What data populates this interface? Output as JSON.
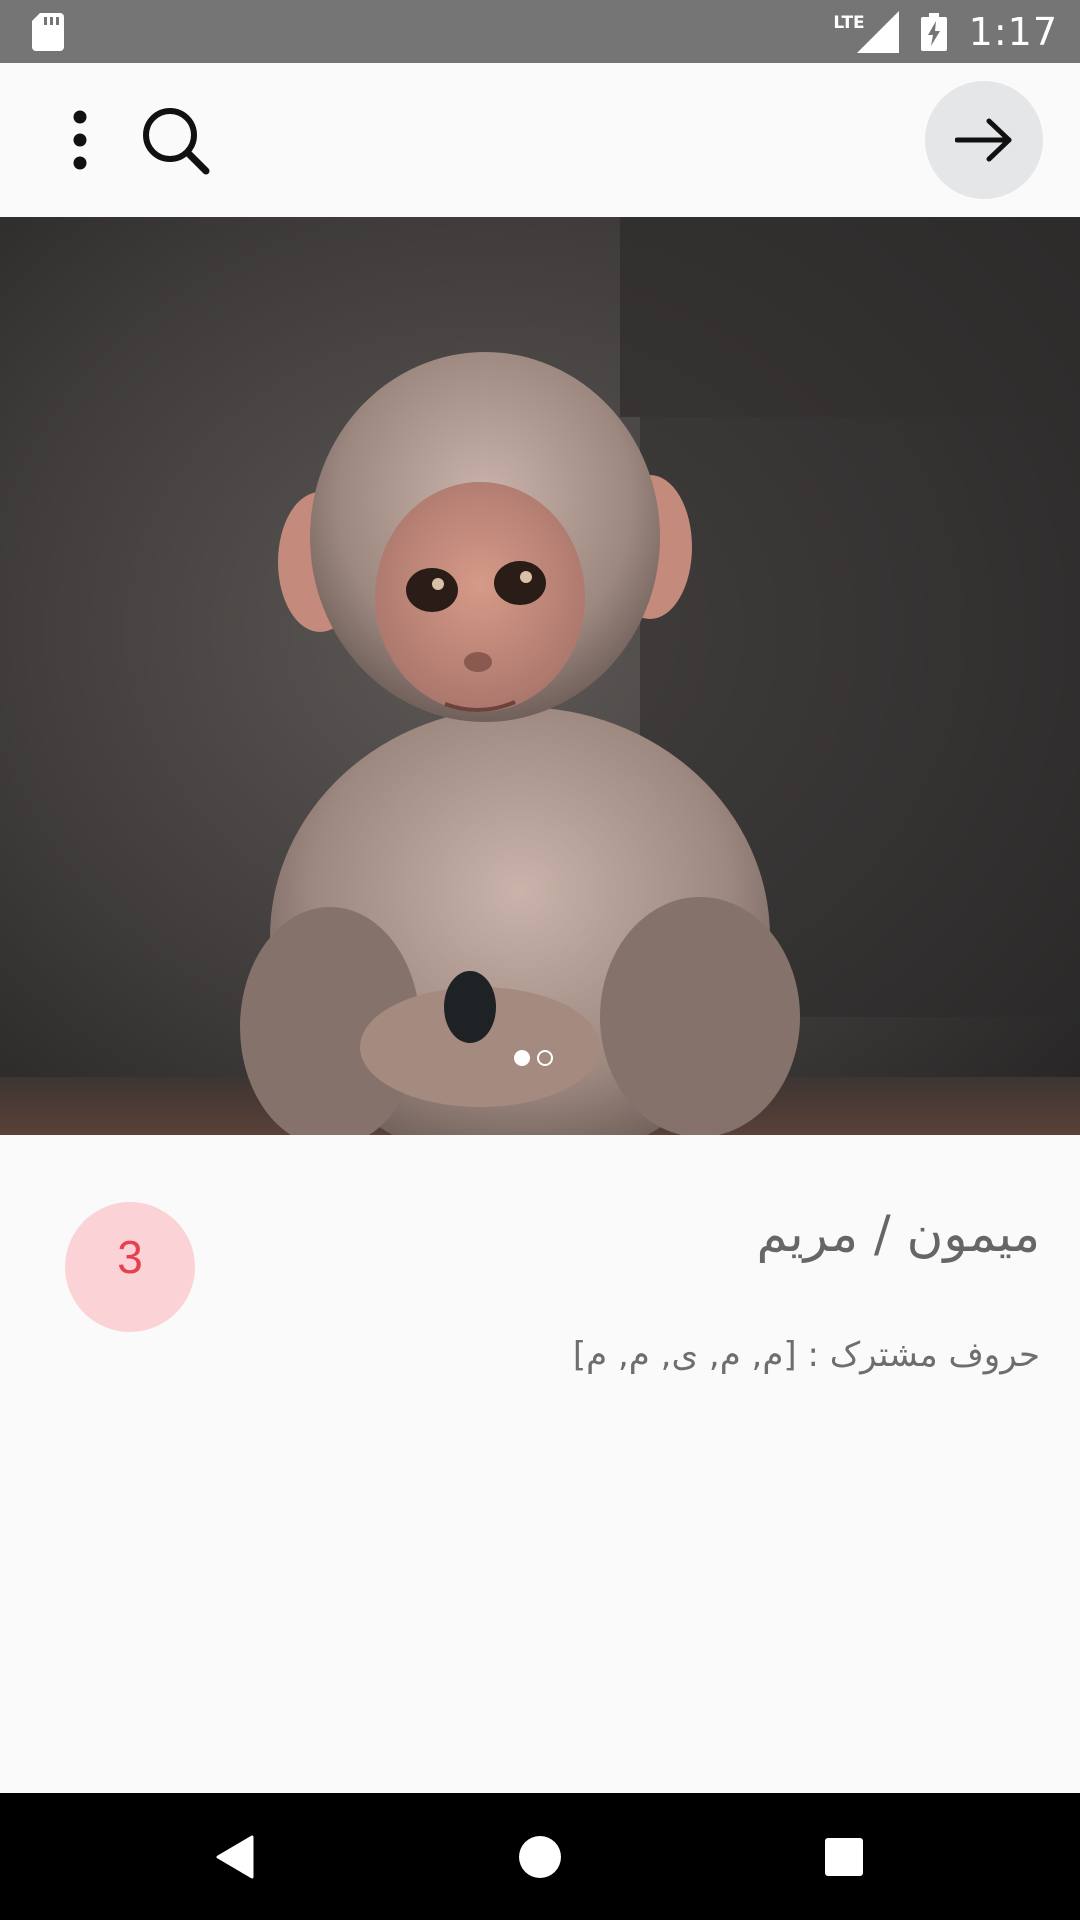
{
  "status_bar": {
    "network": "LTE",
    "time": "1:17",
    "icons": [
      "sd-card-icon",
      "signal-icon",
      "battery-charging-icon"
    ]
  },
  "app_bar": {
    "icons": [
      "more-vert-icon",
      "search-icon",
      "arrow-forward-icon"
    ]
  },
  "hero": {
    "image_subject": "monkey-photo-icon",
    "pager": {
      "current_page": 1,
      "total_pages": 2
    }
  },
  "content": {
    "badge_count": "3",
    "title": "میمون / مریم",
    "common_letters": "حروف مشترک : [م, م, ی, م, م]"
  },
  "nav_bar": {
    "icons": [
      "back-icon",
      "home-icon",
      "recents-icon"
    ]
  },
  "colors": {
    "status_bar": "#757575",
    "badge_bg": "#fbd3d6",
    "badge_text": "#e8404e",
    "forward_button_bg": "#e4e6e7"
  }
}
